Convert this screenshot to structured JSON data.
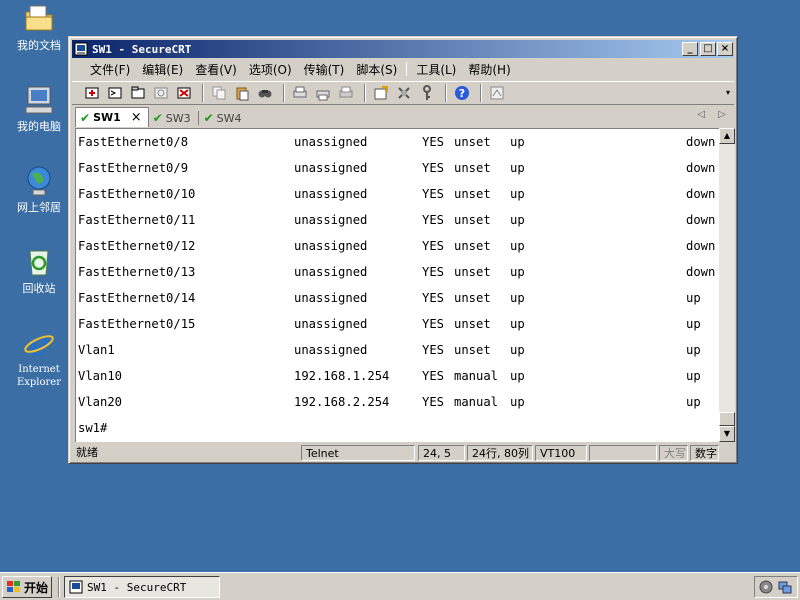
{
  "desktop": {
    "icons": [
      {
        "label": "我的文档"
      },
      {
        "label": "我的电脑"
      },
      {
        "label": "网上邻居"
      },
      {
        "label": "回收站"
      },
      {
        "label": "Internet Explorer"
      }
    ]
  },
  "window": {
    "title": "SW1 - SecureCRT",
    "controls": {
      "minimize": "_",
      "maximize": "□",
      "close": "×"
    }
  },
  "menu": {
    "items": [
      "文件(F)",
      "编辑(E)",
      "查看(V)",
      "选项(O)",
      "传输(T)",
      "脚本(S)",
      "工具(L)",
      "帮助(H)"
    ]
  },
  "tabs": {
    "items": [
      "SW1",
      "SW3",
      "SW4"
    ],
    "close": "×",
    "nav_left": "◁",
    "nav_right": "▷"
  },
  "terminal": {
    "rows": [
      [
        "FastEthernet0/8",
        "unassigned",
        "YES",
        "unset",
        "up",
        "down"
      ],
      [
        "FastEthernet0/9",
        "unassigned",
        "YES",
        "unset",
        "up",
        "down"
      ],
      [
        "FastEthernet0/10",
        "unassigned",
        "YES",
        "unset",
        "up",
        "down"
      ],
      [
        "FastEthernet0/11",
        "unassigned",
        "YES",
        "unset",
        "up",
        "down"
      ],
      [
        "FastEthernet0/12",
        "unassigned",
        "YES",
        "unset",
        "up",
        "down"
      ],
      [
        "FastEthernet0/13",
        "unassigned",
        "YES",
        "unset",
        "up",
        "down"
      ],
      [
        "FastEthernet0/14",
        "unassigned",
        "YES",
        "unset",
        "up",
        "up"
      ],
      [
        "FastEthernet0/15",
        "unassigned",
        "YES",
        "unset",
        "up",
        "up"
      ],
      [
        "Vlan1",
        "unassigned",
        "YES",
        "unset",
        "up",
        "up"
      ],
      [
        "Vlan10",
        "192.168.1.254",
        "YES",
        "manual",
        "up",
        "up"
      ],
      [
        "Vlan20",
        "192.168.2.254",
        "YES",
        "manual",
        "up",
        "up"
      ]
    ],
    "prompt": "sw1#"
  },
  "status": {
    "ready": "就绪",
    "protocol": "Telnet",
    "cursor": "24,  5",
    "size": "24行, 80列",
    "emulation": "VT100",
    "caps": "大写",
    "num": "数字"
  },
  "taskbar": {
    "start": "开始",
    "task": "SW1 - SecureCRT"
  }
}
